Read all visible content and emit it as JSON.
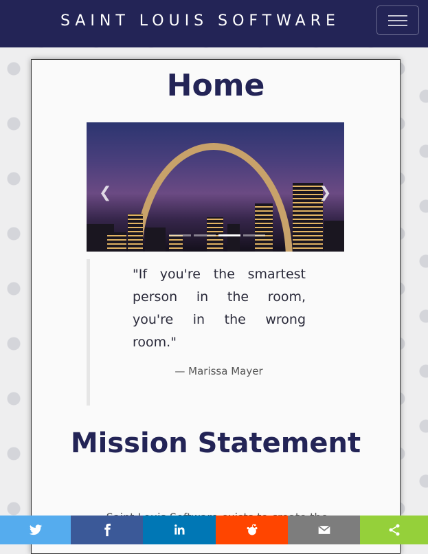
{
  "navbar": {
    "brand": "SAINT LOUIS SOFTWARE",
    "toggle_icon": "hamburger-icon"
  },
  "page": {
    "title": "Home"
  },
  "carousel": {
    "prev_label": "Previous",
    "next_label": "Next",
    "slide_count": 4,
    "active_index": 2
  },
  "quote": {
    "text": "\"If you're the smartest person in the room, you're in the wrong room.\"",
    "author": "— Marissa Mayer"
  },
  "mission": {
    "title": "Mission Statement",
    "body": "Saint Louis Software exists to create the"
  },
  "share": {
    "buttons": [
      {
        "name": "twitter",
        "icon": "twitter-icon",
        "color": "#55acee"
      },
      {
        "name": "facebook",
        "icon": "facebook-icon",
        "color": "#3b5998"
      },
      {
        "name": "linkedin",
        "icon": "linkedin-icon",
        "color": "#0077b5"
      },
      {
        "name": "reddit",
        "icon": "reddit-icon",
        "color": "#ff4500"
      },
      {
        "name": "email",
        "icon": "email-icon",
        "color": "#7d7d7d"
      },
      {
        "name": "sharethis",
        "icon": "share-icon",
        "color": "#95d03a"
      }
    ]
  },
  "colors": {
    "navbar": "#232456",
    "heading": "#232456"
  }
}
